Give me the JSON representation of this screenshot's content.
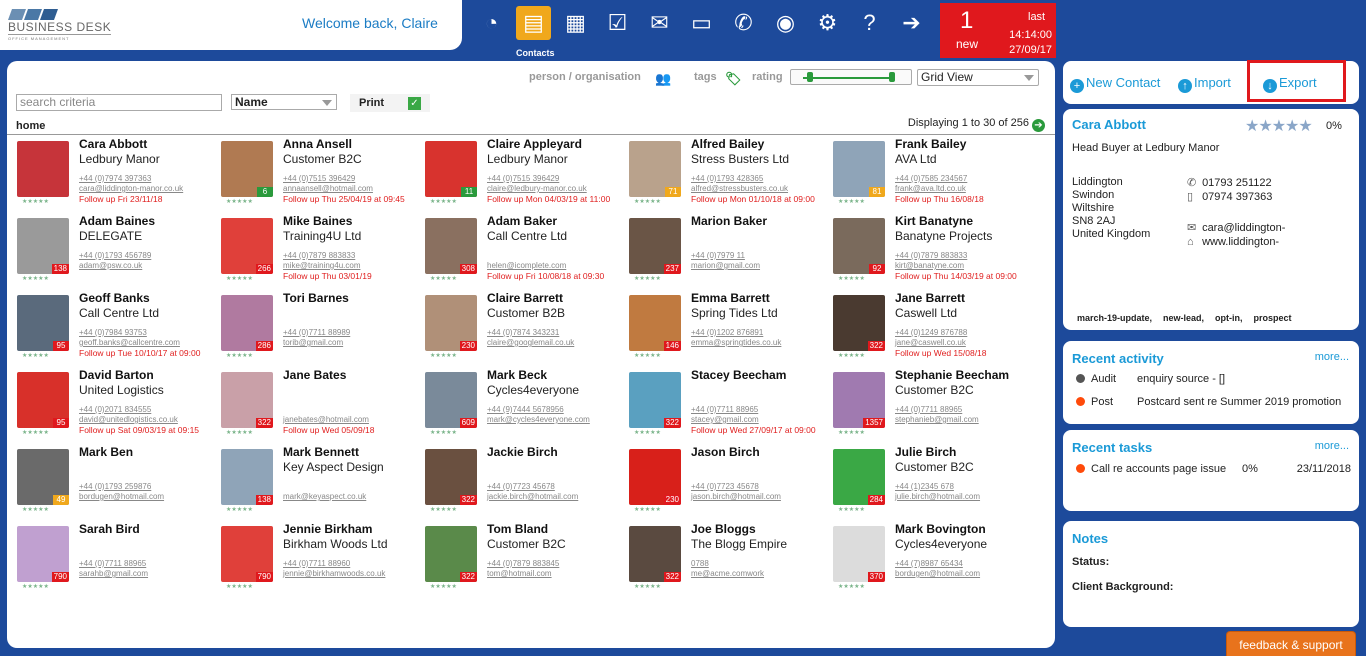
{
  "app": {
    "brand_name": "BUSINESS DESK",
    "brand_sub": "OFFICE MANAGEMENT",
    "welcome": "Welcome back, Claire"
  },
  "nav": {
    "icons": [
      {
        "name": "dashboard-icon",
        "glyph": "◔"
      },
      {
        "name": "contacts-icon",
        "glyph": "▤",
        "active": true
      },
      {
        "name": "calendar-icon",
        "glyph": "▦"
      },
      {
        "name": "tasks-icon",
        "glyph": "☑"
      },
      {
        "name": "mail-icon",
        "glyph": "✉"
      },
      {
        "name": "folder-icon",
        "glyph": "▭"
      },
      {
        "name": "phone-icon",
        "glyph": "✆"
      },
      {
        "name": "user-icon",
        "glyph": "◉"
      },
      {
        "name": "settings-icon",
        "glyph": "⚙"
      },
      {
        "name": "help-icon",
        "glyph": "?"
      },
      {
        "name": "logout-icon",
        "glyph": "➔"
      }
    ],
    "active_label": "Contacts"
  },
  "alert": {
    "count": "1",
    "new_label": "new",
    "last_label": "last",
    "time": "14:14:00",
    "date": "27/09/17"
  },
  "filters": {
    "person_org": "person / organisation",
    "tags": "tags",
    "rating": "rating",
    "view": "Grid View"
  },
  "search": {
    "placeholder": "search criteria",
    "sort": "Name",
    "print": "Print"
  },
  "breadcrumb": "home",
  "displaying": "Displaying 1 to 30 of 256",
  "contacts": [
    {
      "name": "Cara Abbott",
      "company": "Ledbury Manor",
      "phone": "+44 (0)7974 397363",
      "email": "cara@liddington-manor.co.uk",
      "followup": "Follow up Fri 23/11/18",
      "badge": "",
      "badgeColor": "#e0181d",
      "photo": "#c6343a"
    },
    {
      "name": "Anna Ansell",
      "company": "Customer B2C",
      "phone": "+44 (0)7515 396429",
      "email": "annaansell@hotmail.com",
      "followup": "Follow up Thu 25/04/19 at 09:45",
      "badge": "6",
      "badgeColor": "#2a9a3c",
      "photo": "#b07a52"
    },
    {
      "name": "Claire Appleyard",
      "company": "Ledbury Manor",
      "phone": "+44 (0)7515 396429",
      "email": "claire@ledbury-manor.co.uk",
      "followup": "Follow up Mon 04/03/19 at 11:00",
      "badge": "11",
      "badgeColor": "#2a9a3c",
      "photo": "#d8332e"
    },
    {
      "name": "Alfred Bailey",
      "company": "Stress Busters Ltd",
      "phone": "+44 (0)1793 428365",
      "email": "alfred@stressbusters.co.uk",
      "followup": "Follow up Mon 01/10/18 at 09:00",
      "badge": "71",
      "badgeColor": "#f0a81c",
      "photo": "#b9a28c"
    },
    {
      "name": "Frank Bailey",
      "company": "AVA Ltd",
      "phone": "+44 (0)7585 234567",
      "email": "frank@ava.ltd.co.uk",
      "followup": "Follow up Thu 16/08/18",
      "badge": "81",
      "badgeColor": "#f0a81c",
      "photo": "#8fa4b8"
    },
    {
      "name": "Adam Baines",
      "company": "DELEGATE",
      "phone": "+44 (0)1793 456789",
      "email": "adam@psw.co.uk",
      "followup": "",
      "badge": "138",
      "badgeColor": "#e0181d",
      "photo": "#9a9a9a"
    },
    {
      "name": "Mike Baines",
      "company": "Training4U Ltd",
      "phone": "+44 (0)7879 883833",
      "email": "mike@training4u.com",
      "followup": "Follow up Thu 03/01/19",
      "badge": "266",
      "badgeColor": "#e0181d",
      "photo": "#e0403a"
    },
    {
      "name": "Adam Baker",
      "company": "Call Centre Ltd",
      "phone": "",
      "email": "helen@icomplete.com",
      "followup": "Follow up Fri 10/08/18 at 09:30",
      "badge": "308",
      "badgeColor": "#e0181d",
      "photo": "#8a7060"
    },
    {
      "name": "Marion Baker",
      "company": "",
      "phone": "+44 (0)7979 11",
      "email": "marion@gmail.com",
      "followup": "",
      "badge": "237",
      "badgeColor": "#e0181d",
      "photo": "#6a5546"
    },
    {
      "name": "Kirt Banatyne",
      "company": "Banatyne Projects",
      "phone": "+44 (0)7879 883833",
      "email": "kirt@banatyne.com",
      "followup": "Follow up Thu 14/03/19 at 09:00",
      "badge": "92",
      "badgeColor": "#e0181d",
      "photo": "#7a6a5c"
    },
    {
      "name": "Geoff Banks",
      "company": "Call Centre Ltd",
      "phone": "+44 (0)7984 93753",
      "email": "geoff.banks@callcentre.com",
      "followup": "Follow up Tue 10/10/17 at 09:00",
      "badge": "95",
      "badgeColor": "#e0181d",
      "photo": "#5a6a7c"
    },
    {
      "name": "Tori Barnes",
      "company": "",
      "phone": "+44 (0)7711 88989",
      "email": "torib@gmail.com",
      "followup": "",
      "badge": "286",
      "badgeColor": "#e0181d",
      "photo": "#b07aa0"
    },
    {
      "name": "Claire Barrett",
      "company": "Customer B2B",
      "phone": "+44 (0)7874 343231",
      "email": "claire@googlemail.co.uk",
      "followup": "",
      "badge": "230",
      "badgeColor": "#e0181d",
      "photo": "#b09078"
    },
    {
      "name": "Emma Barrett",
      "company": "Spring Tides Ltd",
      "phone": "+44 (0)1202 876891",
      "email": "emma@springtides.co.uk",
      "followup": "",
      "badge": "146",
      "badgeColor": "#e0181d",
      "photo": "#c07a40"
    },
    {
      "name": "Jane Barrett",
      "company": "Caswell Ltd",
      "phone": "+44 (0)1249 876788",
      "email": "jane@caswell.co.uk",
      "followup": "Follow up Wed 15/08/18",
      "badge": "322",
      "badgeColor": "#e0181d",
      "photo": "#4a3a30"
    },
    {
      "name": "David Barton",
      "company": "United Logistics",
      "phone": "+44 (0)2071 834555",
      "email": "david@unitedlogistics.co.uk",
      "followup": "Follow up Sat 09/03/19 at 09:15",
      "badge": "95",
      "badgeColor": "#e0181d",
      "photo": "#d8302a"
    },
    {
      "name": "Jane Bates",
      "company": "",
      "phone": "",
      "email": "janebates@hotmail.com",
      "followup": "Follow up Wed 05/09/18",
      "badge": "322",
      "badgeColor": "#e0181d",
      "photo": "#c9a0a8"
    },
    {
      "name": "Mark Beck",
      "company": "Cycles4everyone",
      "phone": "+44 (9)7444 5678956",
      "email": "mark@cycles4everyone.com",
      "followup": "",
      "badge": "609",
      "badgeColor": "#e0181d",
      "photo": "#7a8a9a"
    },
    {
      "name": "Stacey Beecham",
      "company": "",
      "phone": "+44 (0)7711 88965",
      "email": "stacey@gmail.com",
      "followup": "Follow up Wed 27/09/17 at 09:00",
      "badge": "322",
      "badgeColor": "#e0181d",
      "photo": "#5aa0c0"
    },
    {
      "name": "Stephanie Beecham",
      "company": "Customer B2C",
      "phone": "+44 (0)7711 88965",
      "email": "stephanieb@gmail.com",
      "followup": "",
      "badge": "1357",
      "badgeColor": "#e0181d",
      "photo": "#a07ab0"
    },
    {
      "name": "Mark Ben",
      "company": "",
      "phone": "+44 (0)1793 259876",
      "email": "bordugen@hotmail.com",
      "followup": "",
      "badge": "49",
      "badgeColor": "#f0a81c",
      "photo": "#6a6a6a"
    },
    {
      "name": "Mark Bennett",
      "company": "Key Aspect Design",
      "phone": "",
      "email": "mark@keyaspect.co.uk",
      "followup": "",
      "badge": "138",
      "badgeColor": "#e0181d",
      "photo": "#8fa4b8"
    },
    {
      "name": "Jackie Birch",
      "company": "",
      "phone": "+44 (0)7723 45678",
      "email": "jackie.birch@hotmail.com",
      "followup": "",
      "badge": "322",
      "badgeColor": "#e0181d",
      "photo": "#6a5040"
    },
    {
      "name": "Jason Birch",
      "company": "",
      "phone": "+44 (0)7723 45678",
      "email": "jason.birch@hotmail.com",
      "followup": "",
      "badge": "230",
      "badgeColor": "#e0181d",
      "photo": "#d8201a"
    },
    {
      "name": "Julie Birch",
      "company": "Customer B2C",
      "phone": "+44 (1)2345 678",
      "email": "julie.birch@hotmail.com",
      "followup": "",
      "badge": "284",
      "badgeColor": "#e0181d",
      "photo": "#3aa845"
    },
    {
      "name": "Sarah Bird",
      "company": "",
      "phone": "+44 (0)7711 88965",
      "email": "sarahb@gmail.com",
      "followup": "",
      "badge": "790",
      "badgeColor": "#e0181d",
      "photo": "#c0a0d0"
    },
    {
      "name": "Jennie Birkham",
      "company": "Birkham Woods Ltd",
      "phone": "+44 (0)7711 88960",
      "email": "jennie@birkhamwoods.co.uk",
      "followup": "",
      "badge": "790",
      "badgeColor": "#e0181d",
      "photo": "#e0403a"
    },
    {
      "name": "Tom Bland",
      "company": "Customer B2C",
      "phone": "+44 (0)7879 883845",
      "email": "tom@hotmail.com",
      "followup": "",
      "badge": "322",
      "badgeColor": "#e0181d",
      "photo": "#5a8a4a"
    },
    {
      "name": "Joe Bloggs",
      "company": "The Blogg Empire",
      "phone": "0788",
      "email": "me@acme.comwork",
      "followup": "",
      "badge": "322",
      "badgeColor": "#e0181d",
      "photo": "#5a4a40"
    },
    {
      "name": "Mark Bovington",
      "company": "Cycles4everyone",
      "phone": "+44 (7)8987 65434",
      "email": "bordugen@hotmail.com",
      "followup": "",
      "badge": "370",
      "badgeColor": "#e0181d",
      "photo": "#dcdcdc"
    }
  ],
  "actions": {
    "new_contact": "New Contact",
    "import": "Import",
    "export": "Export"
  },
  "selected": {
    "name": "Cara Abbott",
    "pct": "0%",
    "title": "Head Buyer at Ledbury Manor",
    "address": [
      "Liddington",
      "Swindon",
      "Wiltshire",
      "SN8 2AJ",
      "United Kingdom"
    ],
    "phone1": "01793 251122",
    "phone2": "07974 397363",
    "email": "cara@liddington-",
    "web": "www.liddington-",
    "tags": [
      "march-19-update,",
      "new-lead,",
      "opt-in,",
      "prospect"
    ]
  },
  "activity": {
    "title": "Recent activity",
    "more": "more...",
    "rows": [
      {
        "type": "Audit",
        "text": "enquiry source - []",
        "color": "#555555"
      },
      {
        "type": "Post",
        "text": "Postcard sent re Summer 2019 promotion",
        "color": "#ff4a0a"
      }
    ]
  },
  "tasks": {
    "title": "Recent tasks",
    "more": "more...",
    "rows": [
      {
        "text": "Call re accounts page issue",
        "pct": "0%",
        "date": "23/11/2018",
        "color": "#ff4a0a"
      }
    ]
  },
  "notes": {
    "title": "Notes",
    "status": "Status:",
    "background": "Client Background:"
  },
  "feedback": "feedback & support"
}
